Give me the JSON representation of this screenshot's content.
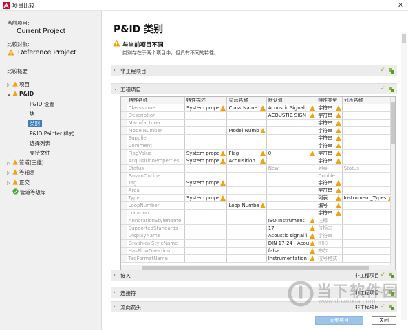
{
  "window": {
    "title": "项目比较",
    "close_glyph": "✕"
  },
  "sidebar": {
    "current_label": "当前项目:",
    "current_project": "Current Project",
    "compare_label": "比较对象:",
    "reference_project": "Reference Project",
    "overview_label": "比较概要",
    "tree": [
      {
        "label": "项目",
        "arrow": "▷",
        "warn": true
      },
      {
        "label": "P&ID",
        "arrow": "◢",
        "warn": true
      },
      {
        "label": "P&ID 设置"
      },
      {
        "label": "块"
      },
      {
        "label": "类别",
        "selected": true
      },
      {
        "label": "P&ID Painter 样式"
      },
      {
        "label": "选择列表"
      },
      {
        "label": "支持文件"
      },
      {
        "label": "管道(三维)",
        "arrow": "▷",
        "warn": true
      },
      {
        "label": "等轴测",
        "arrow": "▷",
        "warn": true
      },
      {
        "label": "正交",
        "arrow": "▷",
        "warn": true
      },
      {
        "label": "管道等级库",
        "check": true
      }
    ]
  },
  "main": {
    "title": "P&ID 类别",
    "warning_title": "与当前项目不同",
    "warning_desc": "类别存在于两个项目中，但具有不同的特性。",
    "sections": {
      "nonengineering": {
        "label": "非工程项目",
        "caret": "›"
      },
      "engineering": {
        "label": "工程项目",
        "caret": "⌄"
      },
      "connectors": {
        "label": "接入",
        "caret": "›",
        "right": "非工程项目"
      },
      "joins": {
        "label": "连接符",
        "caret": "›",
        "right": "非工程项目"
      },
      "flow": {
        "label": "流向箭头",
        "caret": "›",
        "right": "非工程项目"
      }
    },
    "table": {
      "headers": [
        "特性名称",
        "特性描述",
        "显示名称",
        "默认值",
        "特性类型",
        "列表名称"
      ],
      "rows": [
        {
          "c": [
            "ClassName",
            "System prope",
            "Class Name",
            "Acoustic Signal",
            "字符串",
            ""
          ],
          "g": [
            true,
            false,
            false,
            false,
            false,
            false
          ],
          "w": [
            false,
            true,
            true,
            true,
            true,
            false
          ]
        },
        {
          "c": [
            "Description",
            "",
            "",
            "ACOUSTIC SIGN",
            "字符串",
            ""
          ],
          "g": [
            true,
            false,
            false,
            false,
            false,
            false
          ],
          "w": [
            false,
            false,
            false,
            true,
            true,
            false
          ]
        },
        {
          "c": [
            "Manufacturer",
            "",
            "",
            "",
            "字符串",
            ""
          ],
          "g": [
            true,
            false,
            false,
            false,
            false,
            false
          ],
          "w": [
            false,
            false,
            false,
            false,
            true,
            false
          ]
        },
        {
          "c": [
            "ModelNumber",
            "",
            "Model Numb",
            "",
            "字符串",
            ""
          ],
          "g": [
            true,
            false,
            false,
            false,
            false,
            false
          ],
          "w": [
            false,
            false,
            true,
            false,
            true,
            false
          ]
        },
        {
          "c": [
            "Supplier",
            "",
            "",
            "",
            "字符串",
            ""
          ],
          "g": [
            true,
            false,
            false,
            false,
            false,
            false
          ],
          "w": [
            false,
            false,
            false,
            false,
            true,
            false
          ]
        },
        {
          "c": [
            "Comment",
            "",
            "",
            "",
            "字符串",
            ""
          ],
          "g": [
            true,
            false,
            false,
            false,
            false,
            false
          ],
          "w": [
            false,
            false,
            false,
            false,
            true,
            false
          ]
        },
        {
          "c": [
            "FlagValue",
            "System prope",
            "Flag",
            "0",
            "字符串",
            ""
          ],
          "g": [
            true,
            false,
            false,
            false,
            false,
            false
          ],
          "w": [
            false,
            true,
            true,
            true,
            true,
            false
          ]
        },
        {
          "c": [
            "AcquisitionProperties",
            "System prope",
            "Acquisition",
            "",
            "字符串",
            ""
          ],
          "g": [
            true,
            false,
            false,
            false,
            false,
            false
          ],
          "w": [
            false,
            true,
            true,
            false,
            true,
            false
          ]
        },
        {
          "c": [
            "Status",
            "",
            "",
            "New",
            "列表",
            "Status"
          ],
          "g": [
            true,
            true,
            true,
            true,
            true,
            true
          ],
          "w": [
            false,
            false,
            false,
            false,
            false,
            false
          ]
        },
        {
          "c": [
            "ParamOnLine",
            "",
            "",
            "",
            "Double",
            ""
          ],
          "g": [
            true,
            true,
            true,
            true,
            true,
            true
          ],
          "w": [
            false,
            false,
            false,
            false,
            false,
            false
          ]
        },
        {
          "c": [
            "Tag",
            "System prope",
            "",
            "",
            "字符串",
            ""
          ],
          "g": [
            true,
            false,
            false,
            false,
            false,
            false
          ],
          "w": [
            false,
            true,
            false,
            false,
            true,
            false
          ]
        },
        {
          "c": [
            "Area",
            "",
            "",
            "",
            "字符串",
            ""
          ],
          "g": [
            true,
            false,
            false,
            false,
            false,
            false
          ],
          "w": [
            false,
            false,
            false,
            false,
            true,
            false
          ]
        },
        {
          "c": [
            "Type",
            "System prope",
            "",
            "",
            "列表",
            "Instrument_Types"
          ],
          "g": [
            true,
            false,
            false,
            false,
            false,
            false
          ],
          "w": [
            false,
            true,
            false,
            false,
            true,
            true
          ]
        },
        {
          "c": [
            "LoopNumber",
            "",
            "Loop Numbe",
            "",
            "编号",
            ""
          ],
          "g": [
            true,
            false,
            false,
            false,
            false,
            false
          ],
          "w": [
            false,
            false,
            true,
            false,
            true,
            false
          ]
        },
        {
          "c": [
            "Location",
            "",
            "",
            "",
            "字符串",
            ""
          ],
          "g": [
            true,
            false,
            false,
            false,
            false,
            false
          ],
          "w": [
            false,
            false,
            false,
            false,
            true,
            false
          ]
        },
        {
          "c": [
            "AnnotationStyleName",
            "",
            "",
            "ISO Instrument",
            "注释",
            ""
          ],
          "g": [
            true,
            false,
            false,
            false,
            true,
            false
          ],
          "w": [
            false,
            false,
            false,
            true,
            false,
            false
          ]
        },
        {
          "c": [
            "SupportedStandards",
            "",
            "",
            "17",
            "位标志",
            ""
          ],
          "g": [
            true,
            false,
            false,
            false,
            true,
            false
          ],
          "w": [
            false,
            false,
            false,
            true,
            false,
            false
          ]
        },
        {
          "c": [
            "DisplayName",
            "",
            "",
            "Acoustic signal i",
            "字符串",
            ""
          ],
          "g": [
            true,
            false,
            false,
            false,
            true,
            false
          ],
          "w": [
            false,
            false,
            false,
            true,
            false,
            false
          ]
        },
        {
          "c": [
            "GraphicalStyleName",
            "",
            "",
            "DIN 17-24 - Acou",
            "图形",
            ""
          ],
          "g": [
            true,
            false,
            false,
            false,
            true,
            false
          ],
          "w": [
            false,
            false,
            false,
            true,
            false,
            false
          ]
        },
        {
          "c": [
            "HasFlowDirection",
            "",
            "",
            "false",
            "布尔",
            ""
          ],
          "g": [
            true,
            false,
            false,
            false,
            true,
            false
          ],
          "w": [
            false,
            false,
            false,
            true,
            false,
            false
          ]
        },
        {
          "c": [
            "TagFormatName",
            "",
            "",
            "Instrumentation",
            "位号格式",
            ""
          ],
          "g": [
            true,
            false,
            false,
            false,
            true,
            false
          ],
          "w": [
            false,
            false,
            false,
            true,
            false,
            false
          ]
        }
      ]
    },
    "buttons": {
      "sync": "同步项目",
      "close": "关闭"
    }
  },
  "watermark": {
    "text": "当下软件园",
    "sub": "www.downxia.com"
  },
  "colors": {
    "accent": "#3d7ebf",
    "warning": "#f0a30a",
    "ok": "#8ab84a",
    "sync_button": "#9cc4e8"
  }
}
